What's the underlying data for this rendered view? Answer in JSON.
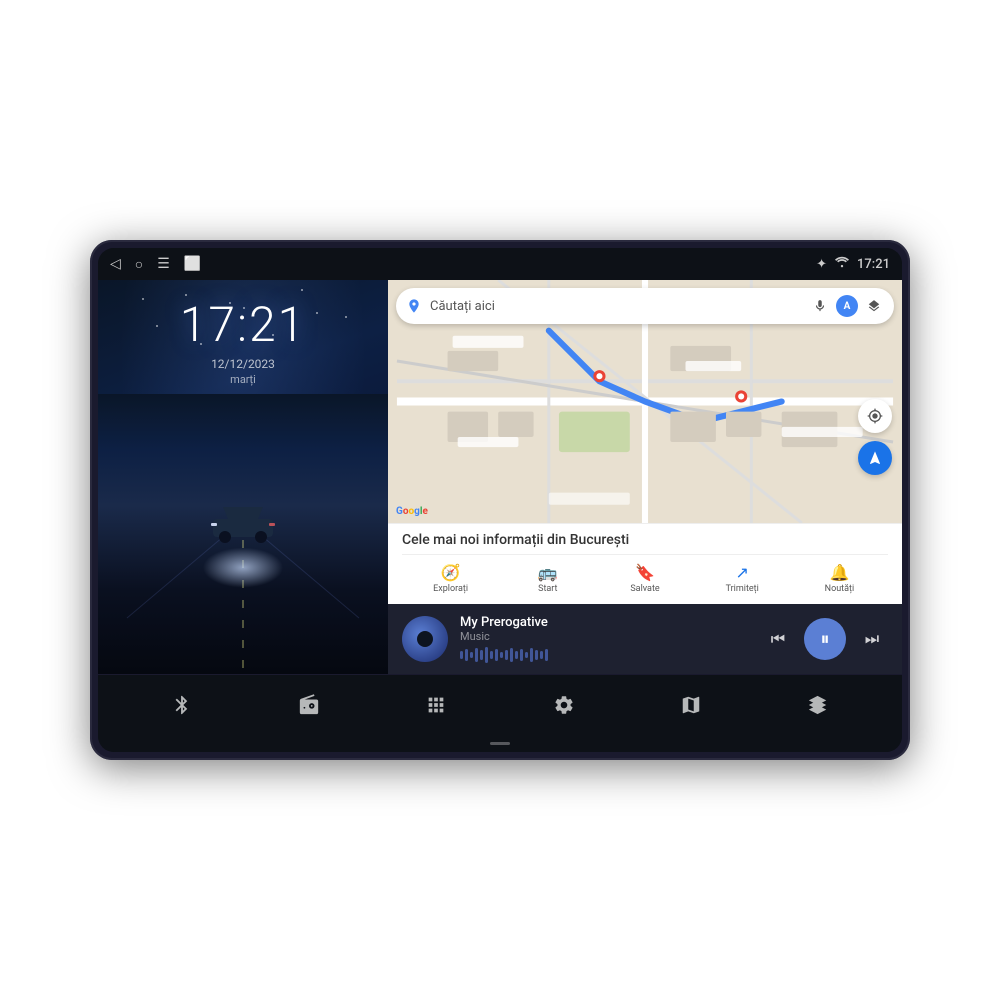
{
  "device": {
    "status_bar": {
      "time": "17:21",
      "icons": {
        "back": "◁",
        "home": "○",
        "menu": "☰",
        "screen": "⬜"
      },
      "right_icons": {
        "bluetooth": "✦",
        "wifi": "WiFi",
        "signal": "WiFi"
      }
    },
    "lock_screen": {
      "time": "17:21",
      "date": "12/12/2023",
      "day": "marți"
    },
    "map": {
      "search_placeholder": "Căutați aici",
      "info_title": "Cele mai noi informații din București",
      "tabs": [
        {
          "icon": "🧭",
          "label": "Explorați"
        },
        {
          "icon": "🚌",
          "label": "Start"
        },
        {
          "icon": "🔖",
          "label": "Salvate"
        },
        {
          "icon": "↗",
          "label": "Trimiteți"
        },
        {
          "icon": "🔔",
          "label": "Noutăți"
        }
      ]
    },
    "music": {
      "title": "My Prerogative",
      "subtitle": "Music",
      "controls": {
        "prev": "⏮",
        "play": "⏸",
        "next": "⏭"
      }
    },
    "taskbar": {
      "items": [
        {
          "icon": "bluetooth",
          "unicode": "✦"
        },
        {
          "icon": "radio",
          "unicode": "📻"
        },
        {
          "icon": "apps",
          "unicode": "⊞"
        },
        {
          "icon": "settings",
          "unicode": "⚙"
        },
        {
          "icon": "maps",
          "unicode": "🗺"
        },
        {
          "icon": "3d-box",
          "unicode": "◈"
        }
      ]
    }
  },
  "waveform_heights": [
    8,
    12,
    6,
    14,
    10,
    16,
    8,
    12,
    6,
    10,
    14,
    8,
    12,
    6,
    14,
    10,
    8,
    12
  ]
}
